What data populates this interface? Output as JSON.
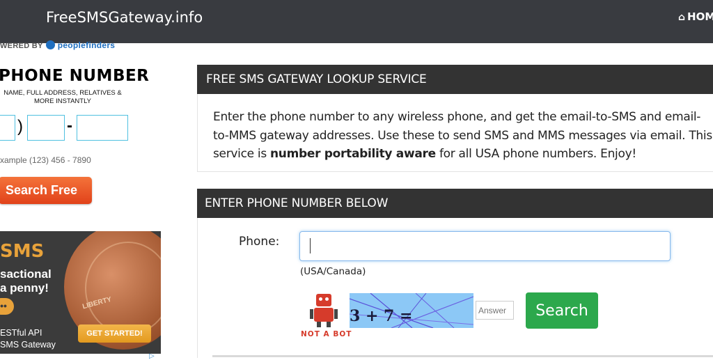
{
  "navbar": {
    "brand": "FreeSMSGateway.info",
    "home_label": "HOME",
    "home_icon": "home-icon",
    "background": "#393b40"
  },
  "sidebar_ad": {
    "powered_by": "WERED BY",
    "powered_brand": "peoplefinders",
    "title": "PHONE NUMBER",
    "subtitle": "NAME, FULL ADDRESS, RELATIVES & MORE INSTANTLY",
    "example": "xample (123) 456 - 7890",
    "search_button": "Search Free",
    "search_button_color": "#e1421a"
  },
  "sms_ad": {
    "headline": "SMS",
    "line1": "sactional",
    "line2": "a penny!",
    "line3": "ESTful API",
    "line4": "SMS Gateway",
    "coin_text": "LIBERTY",
    "cta": "GET STARTED!"
  },
  "lookup_panel": {
    "title": "FREE SMS GATEWAY LOOKUP SERVICE",
    "text_before": "Enter the phone number to any wireless phone, and get the email-to-SMS and email-to-MMS gateway addresses. Use these to send SMS and MMS messages via email. This service is ",
    "text_bold": "number portability aware",
    "text_after": " for all USA phone numbers. Enjoy!"
  },
  "phone_panel": {
    "title": "ENTER PHONE NUMBER BELOW",
    "phone_label": "Phone:",
    "phone_value": "",
    "phone_hint": "(USA/Canada)",
    "not_a_bot": "NOT A BOT",
    "captcha_text": "3 + 7 =",
    "answer_placeholder": "Answer",
    "search_button": "Search",
    "search_color": "#2ca84c"
  }
}
